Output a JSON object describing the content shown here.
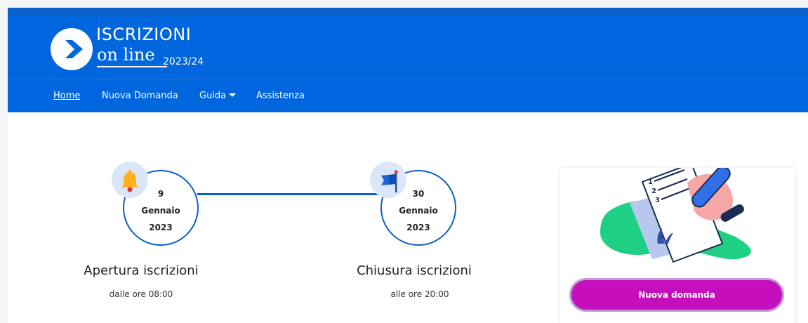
{
  "header": {
    "logo_title": "ISCRIZIONI",
    "logo_subtitle": "on line",
    "logo_year": "2023/24"
  },
  "nav": {
    "items": [
      {
        "label": "Home"
      },
      {
        "label": "Nuova Domanda"
      },
      {
        "label": "Guida"
      },
      {
        "label": "Assistenza"
      }
    ]
  },
  "timeline": {
    "opening": {
      "day": "9",
      "month": "Gennaio",
      "year": "2023",
      "title": "Apertura iscrizioni",
      "subtitle": "dalle ore 08:00",
      "icon": "bell-icon"
    },
    "closing": {
      "day": "30",
      "month": "Gennaio",
      "year": "2023",
      "title": "Chiusura iscrizioni",
      "subtitle": "alle ore 20:00",
      "icon": "flag-icon"
    }
  },
  "card": {
    "button_label": "Nuova domanda",
    "illustration": "checklist-illustration"
  },
  "colors": {
    "primary_blue": "#0066de",
    "accent_magenta": "#c50fbc",
    "illustration_green": "#1fcf83"
  }
}
